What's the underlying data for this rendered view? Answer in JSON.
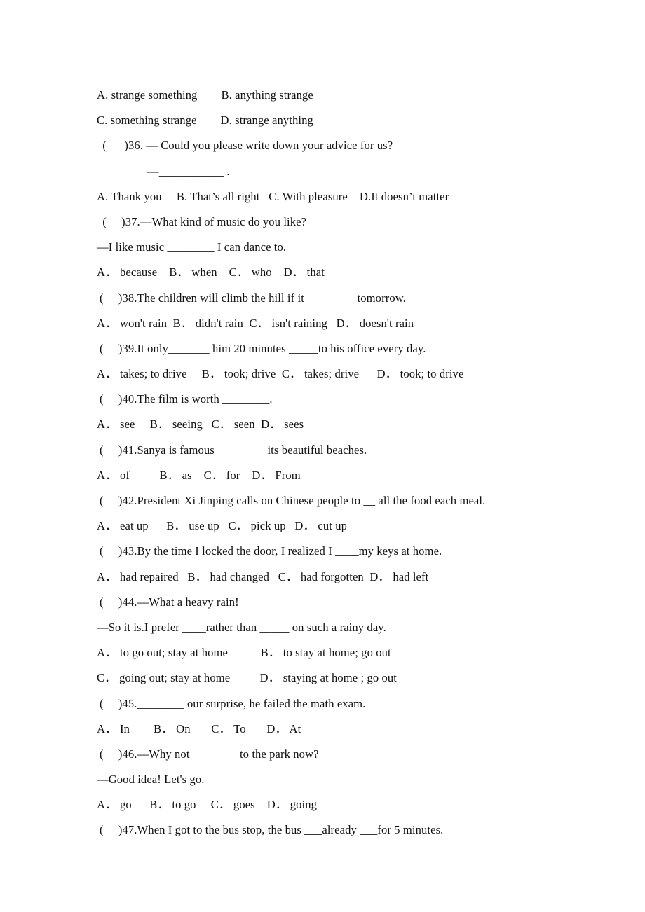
{
  "document": {
    "type": "english-multiple-choice-exam",
    "page_background": "#ffffff",
    "text_color": "#111111",
    "lines": [
      {
        "id": "l01",
        "kind": "option",
        "text": "A. strange something        B. anything strange"
      },
      {
        "id": "l02",
        "kind": "option",
        "text": "C. something strange        D. strange anything"
      },
      {
        "id": "l03",
        "kind": "question",
        "number": "36",
        "text": " (      )36. — Could you please write down your advice for us?"
      },
      {
        "id": "l04",
        "kind": "continuation",
        "text": "—___________ ."
      },
      {
        "id": "l05",
        "kind": "option",
        "text": "A. Thank you     B. That’s all right   C. With pleasure    D.It doesn’t matter"
      },
      {
        "id": "l06",
        "kind": "question",
        "number": "37",
        "text": " (     )37.—What kind of music do you like?"
      },
      {
        "id": "l07",
        "kind": "continuation",
        "text": "—I like music ________ I can dance to."
      },
      {
        "id": "l08",
        "kind": "option",
        "text": "A． because    B． when    C． who    D． that"
      },
      {
        "id": "l09",
        "kind": "question",
        "number": "38",
        "text": "(     )38.The children will climb the hill if it ________ tomorrow."
      },
      {
        "id": "l10",
        "kind": "option",
        "text": "A． won't rain  B． didn't rain  C． isn't raining   D． doesn't rain"
      },
      {
        "id": "l11",
        "kind": "question",
        "number": "39",
        "text": "(     )39.It only_______ him 20 minutes _____to his office every day."
      },
      {
        "id": "l12",
        "kind": "option",
        "text": "A． takes; to drive     B． took; drive  C． takes; drive      D． took; to drive"
      },
      {
        "id": "l13",
        "kind": "question",
        "number": "40",
        "text": "(     )40.The film is worth ________."
      },
      {
        "id": "l14",
        "kind": "option",
        "text": "A． see     B． seeing   C． seen  D． sees"
      },
      {
        "id": "l15",
        "kind": "question",
        "number": "41",
        "text": "(     )41.Sanya is famous ________ its beautiful beaches."
      },
      {
        "id": "l16",
        "kind": "option",
        "text": "A． of          B． as    C． for    D． From"
      },
      {
        "id": "l17",
        "kind": "question",
        "number": "42",
        "text": "(     )42.President Xi Jinping calls on Chinese people to __ all the food each meal."
      },
      {
        "id": "l18",
        "kind": "option",
        "text": "A． eat up      B． use up   C． pick up   D． cut up"
      },
      {
        "id": "l19",
        "kind": "question",
        "number": "43",
        "text": "(     )43.By the time I locked the door, I realized I ____my keys at home."
      },
      {
        "id": "l20",
        "kind": "option",
        "text": "A． had repaired   B． had changed   C． had forgotten  D． had left"
      },
      {
        "id": "l21",
        "kind": "question",
        "number": "44",
        "text": "(     )44.—What a heavy rain!"
      },
      {
        "id": "l22",
        "kind": "continuation",
        "text": "—So it is.I prefer ____rather than _____ on such a rainy day."
      },
      {
        "id": "l23",
        "kind": "option",
        "text": "A． to go out; stay at home           B． to stay at home; go out"
      },
      {
        "id": "l24",
        "kind": "option",
        "text": "C． going out; stay at home          D． staying at home ; go out"
      },
      {
        "id": "l25",
        "kind": "question",
        "number": "45",
        "text": "(     )45.________ our surprise, he failed the math exam."
      },
      {
        "id": "l26",
        "kind": "option",
        "text": "A． In        B． On       C． To       D． At"
      },
      {
        "id": "l27",
        "kind": "question",
        "number": "46",
        "text": "(     )46.—Why not________ to the park now?"
      },
      {
        "id": "l28",
        "kind": "continuation",
        "text": "—Good idea! Let's go."
      },
      {
        "id": "l29",
        "kind": "option",
        "text": "A． go      B． to go     C． goes    D． going"
      },
      {
        "id": "l30",
        "kind": "question",
        "number": "47",
        "text": "(     )47.When I got to the bus stop, the bus ___already ___for 5 minutes."
      }
    ]
  }
}
